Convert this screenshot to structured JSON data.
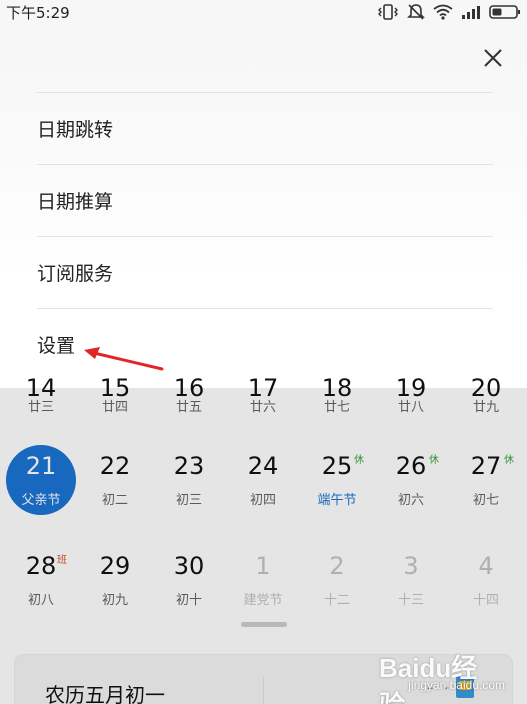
{
  "status_bar": {
    "time": "下午5:29"
  },
  "menu": {
    "close_icon": "close-icon",
    "items": [
      {
        "label": "日期跳转"
      },
      {
        "label": "日期推算"
      },
      {
        "label": "订阅服务"
      },
      {
        "label": "设置"
      }
    ]
  },
  "calendar": {
    "weeks": [
      {
        "days": [
          {
            "num": "14",
            "sub": "廿三"
          },
          {
            "num": "15",
            "sub": "廿四"
          },
          {
            "num": "16",
            "sub": "廿五"
          },
          {
            "num": "17",
            "sub": "廿六"
          },
          {
            "num": "18",
            "sub": "廿七"
          },
          {
            "num": "19",
            "sub": "廿八"
          },
          {
            "num": "20",
            "sub": "廿九"
          }
        ]
      },
      {
        "days": [
          {
            "num": "21",
            "sub": "父亲节",
            "selected": true
          },
          {
            "num": "22",
            "sub": "初二"
          },
          {
            "num": "23",
            "sub": "初三"
          },
          {
            "num": "24",
            "sub": "初四"
          },
          {
            "num": "25",
            "sub": "端午节",
            "badge": "休",
            "sub_color": "#1b74d6"
          },
          {
            "num": "26",
            "sub": "初六",
            "badge": "休"
          },
          {
            "num": "27",
            "sub": "初七",
            "badge": "休"
          }
        ]
      },
      {
        "days": [
          {
            "num": "28",
            "sub": "初八",
            "badge": "班"
          },
          {
            "num": "29",
            "sub": "初九"
          },
          {
            "num": "30",
            "sub": "初十"
          },
          {
            "num": "1",
            "sub": "建党节",
            "muted": true
          },
          {
            "num": "2",
            "sub": "十二",
            "muted": true
          },
          {
            "num": "3",
            "sub": "十三",
            "muted": true
          },
          {
            "num": "4",
            "sub": "十四",
            "muted": true
          }
        ]
      }
    ],
    "lunar_card": {
      "title": "农历五月初一",
      "value": "- -"
    }
  },
  "colors": {
    "selected": "#1b74d6",
    "rest_badge": "#3aa43a",
    "work_badge": "#e0502c",
    "annotation_arrow": "#e0262b"
  },
  "watermark": {
    "brand": "Baidu经验",
    "url": "jingyan.baidu.com"
  }
}
